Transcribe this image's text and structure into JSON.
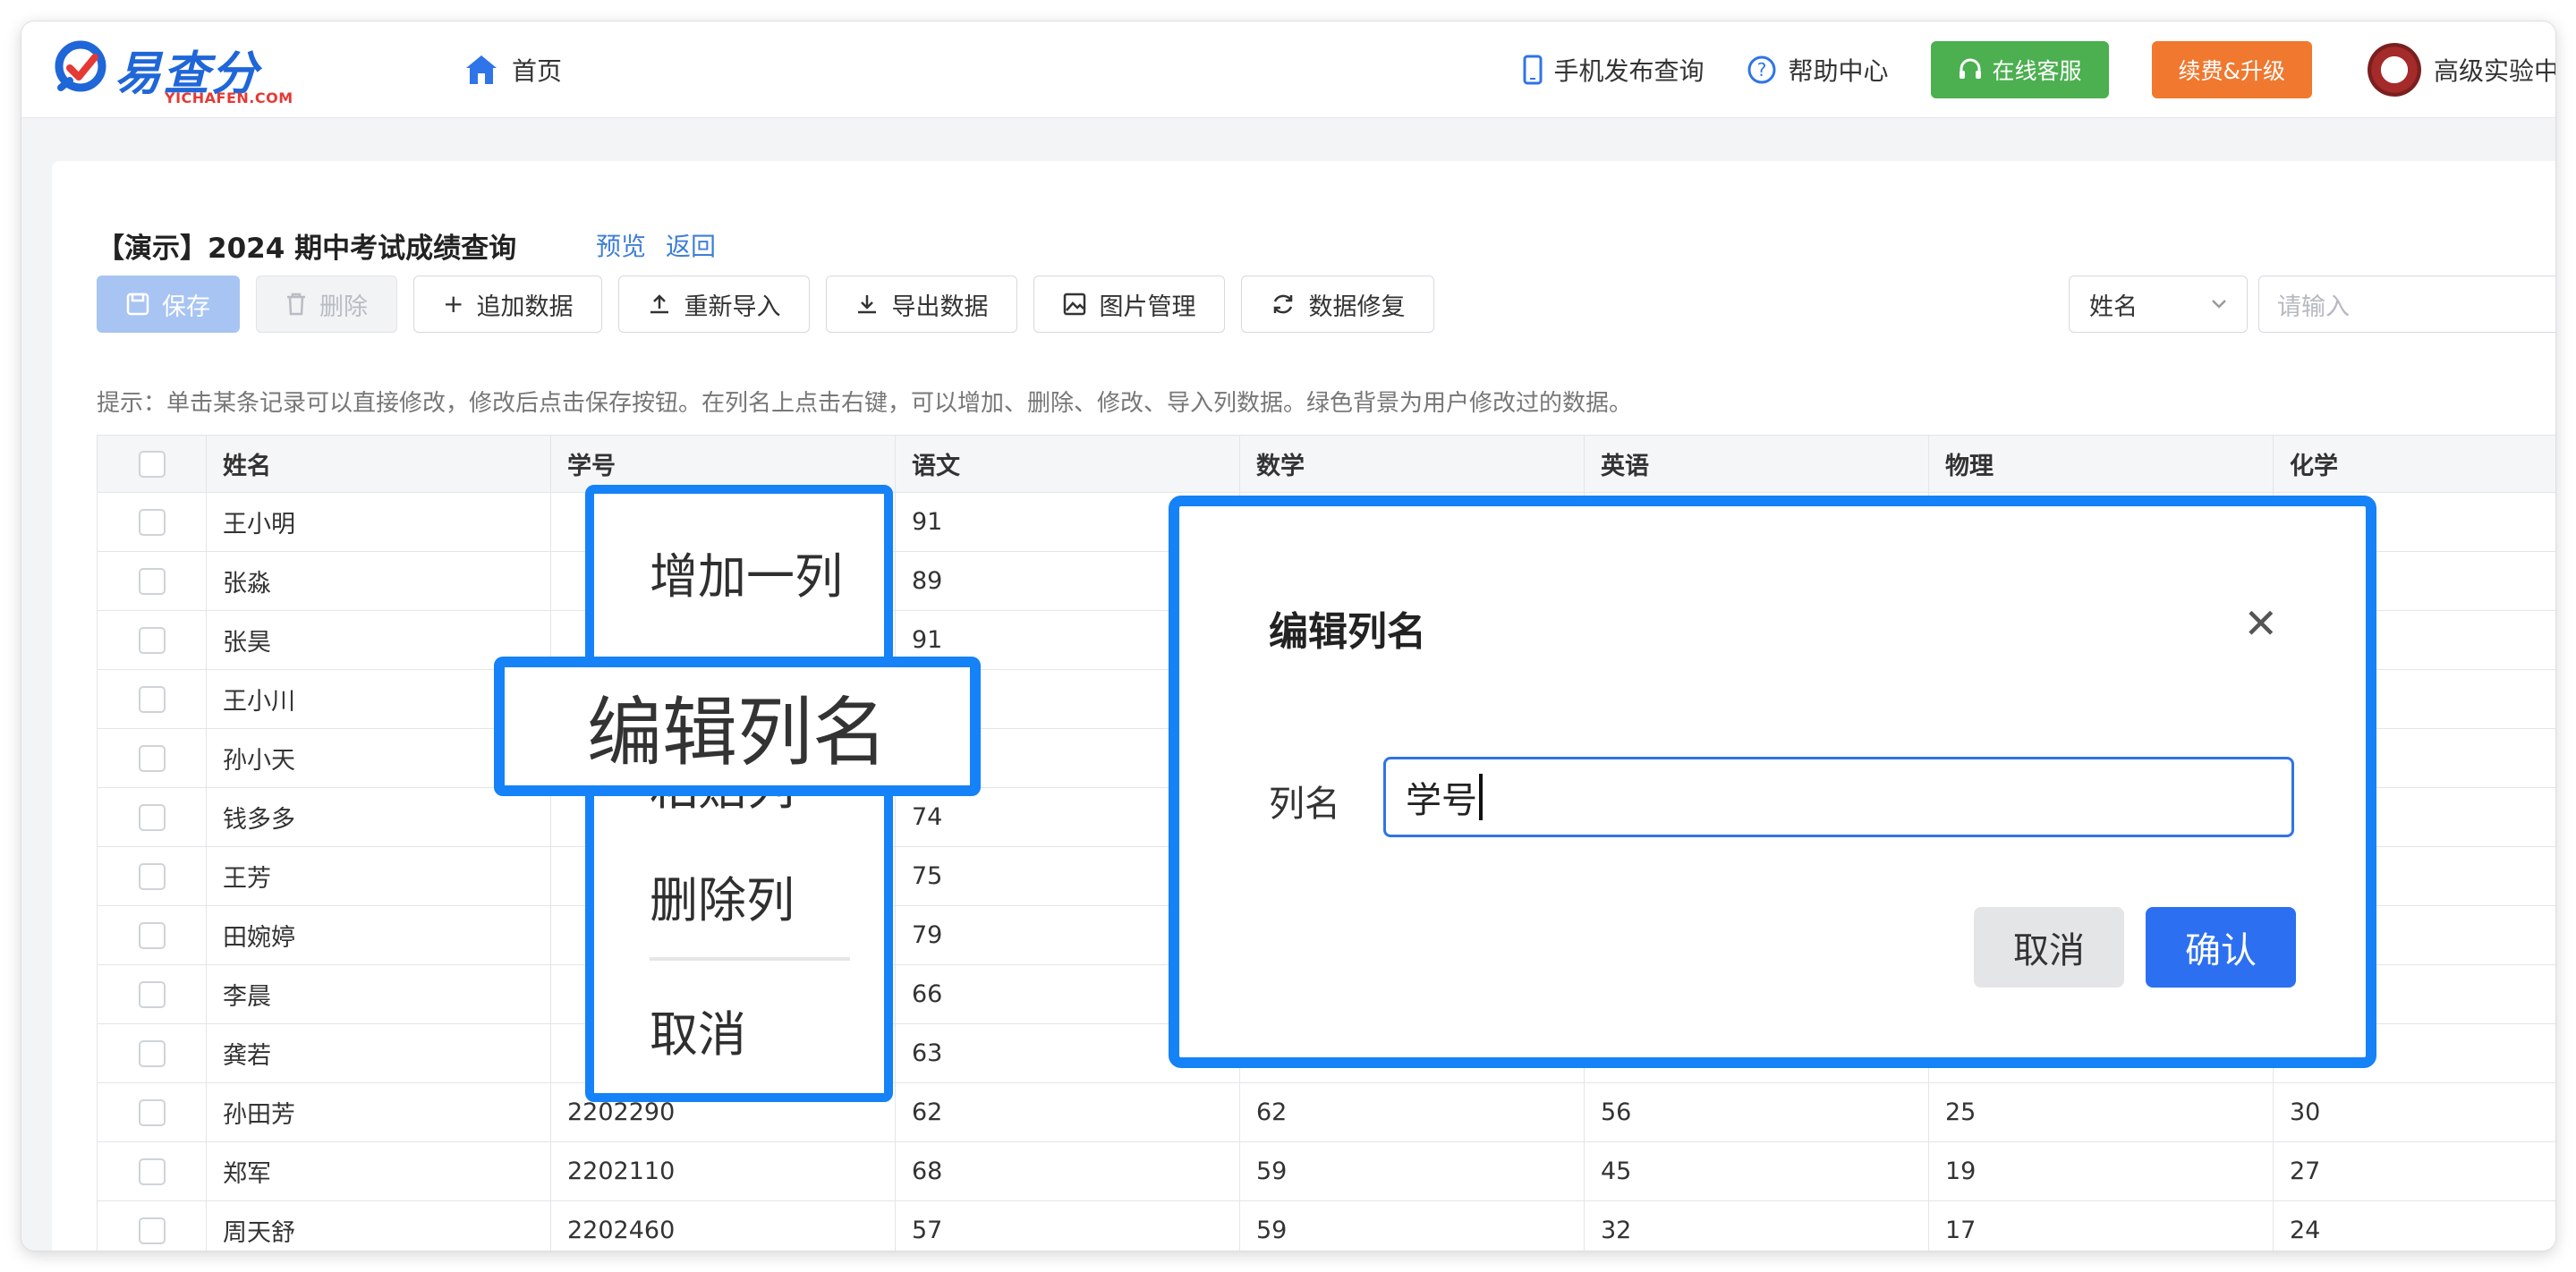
{
  "header": {
    "logo_text": "易查分",
    "logo_sub": "YICHAFEN.COM",
    "home_label": "首页",
    "mobile_query": "手机发布查询",
    "help_center": "帮助中心",
    "online_service": "在线客服",
    "renew_upgrade": "续费&升级",
    "user_name": "高级实验中学"
  },
  "page": {
    "title": "【演示】2024 期中考试成绩查询",
    "preview_link": "预览",
    "back_link": "返回"
  },
  "toolbar": {
    "save": "保存",
    "delete": "删除",
    "append_data": "追加数据",
    "reimport": "重新导入",
    "export_data": "导出数据",
    "image_manage": "图片管理",
    "data_repair": "数据修复"
  },
  "search": {
    "field": "姓名",
    "placeholder": "请输入"
  },
  "tip": "提示：单击某条记录可以直接修改，修改后点击保存按钮。在列名上点击右键，可以增加、删除、修改、导入列数据。绿色背景为用户修改过的数据。",
  "table": {
    "headers": [
      "姓名",
      "学号",
      "语文",
      "数学",
      "英语",
      "物理",
      "化学"
    ],
    "rows": [
      [
        "王小明",
        "",
        "91",
        "",
        "",
        "",
        ""
      ],
      [
        "张淼",
        "",
        "89",
        "",
        "",
        "",
        ""
      ],
      [
        "张昊",
        "",
        "91",
        "",
        "",
        "",
        ""
      ],
      [
        "王小川",
        "",
        "",
        "",
        "",
        "",
        ""
      ],
      [
        "孙小天",
        "",
        "",
        "",
        "",
        "",
        ""
      ],
      [
        "钱多多",
        "",
        "74",
        "",
        "",
        "",
        ""
      ],
      [
        "王芳",
        "",
        "75",
        "",
        "",
        "",
        ""
      ],
      [
        "田婉婷",
        "",
        "79",
        "",
        "",
        "",
        ""
      ],
      [
        "李晨",
        "",
        "66",
        "",
        "",
        "",
        ""
      ],
      [
        "龚若",
        "",
        "63",
        "",
        "",
        "",
        ""
      ],
      [
        "孙田芳",
        "2202290",
        "62",
        "62",
        "56",
        "25",
        "30"
      ],
      [
        "郑军",
        "2202110",
        "68",
        "59",
        "45",
        "19",
        "27"
      ],
      [
        "周天舒",
        "2202460",
        "57",
        "59",
        "32",
        "17",
        "24"
      ]
    ]
  },
  "context_menu": {
    "items": [
      "增加一列",
      "编辑列名",
      "粘贴列",
      "删除列",
      "取消"
    ],
    "highlighted": "编辑列名"
  },
  "dialog": {
    "title": "编辑列名",
    "field_label": "列名",
    "field_value": "学号",
    "cancel": "取消",
    "confirm": "确认"
  },
  "colors": {
    "brand_blue": "#1f66d8",
    "highlight_blue": "#1582f7",
    "green_button": "#4caf50",
    "orange_button": "#f0782f",
    "primary_button": "#2c6ff0"
  }
}
